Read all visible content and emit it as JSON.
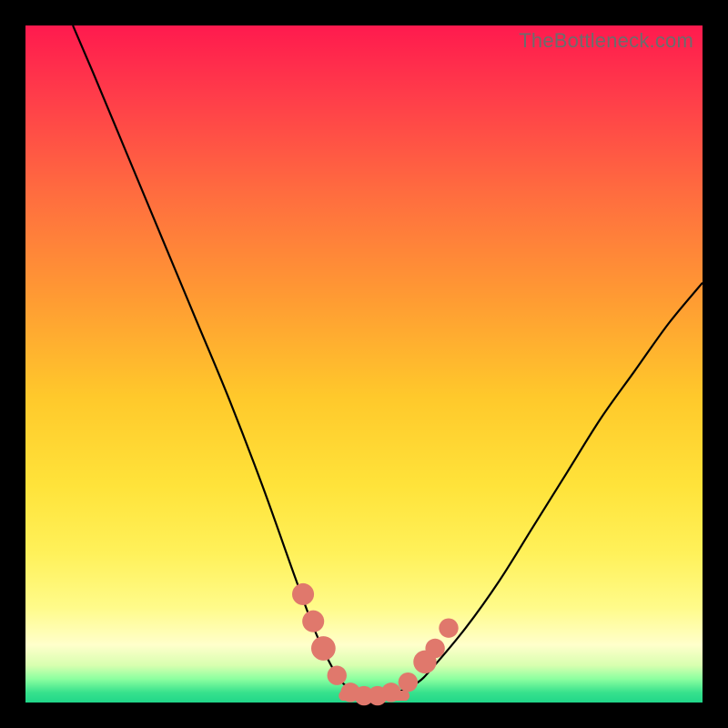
{
  "watermark": "TheBottleneck.com",
  "colors": {
    "page_bg": "#000000",
    "gradient_top": "#ff1a4e",
    "gradient_bottom": "#20d689",
    "curve": "#000000",
    "marker": "#e0786c"
  },
  "chart_data": {
    "type": "line",
    "title": "",
    "xlabel": "",
    "ylabel": "",
    "xlim": [
      0,
      100
    ],
    "ylim": [
      0,
      100
    ],
    "series": [
      {
        "name": "bottleneck-curve",
        "x": [
          7,
          10,
          15,
          20,
          25,
          30,
          35,
          40,
          43,
          46,
          48,
          50,
          52,
          54,
          56,
          58,
          60,
          65,
          70,
          75,
          80,
          85,
          90,
          95,
          100
        ],
        "y": [
          100,
          93,
          81,
          69,
          57,
          45,
          32,
          18,
          10,
          4,
          2,
          1,
          1,
          1,
          2,
          3,
          5,
          11,
          18,
          26,
          34,
          42,
          49,
          56,
          62
        ]
      }
    ],
    "markers": [
      {
        "x": 41,
        "y": 16,
        "r": 1.2
      },
      {
        "x": 42.5,
        "y": 12,
        "r": 1.2
      },
      {
        "x": 44,
        "y": 8,
        "r": 1.4
      },
      {
        "x": 46,
        "y": 4,
        "r": 1.0
      },
      {
        "x": 48,
        "y": 1.5,
        "r": 1.0
      },
      {
        "x": 50,
        "y": 1,
        "r": 1.0
      },
      {
        "x": 52,
        "y": 1,
        "r": 1.0
      },
      {
        "x": 54,
        "y": 1.5,
        "r": 1.0
      },
      {
        "x": 56.5,
        "y": 3,
        "r": 1.0
      },
      {
        "x": 59,
        "y": 6,
        "r": 1.3
      },
      {
        "x": 60.5,
        "y": 8,
        "r": 1.0
      },
      {
        "x": 62.5,
        "y": 11,
        "r": 1.0
      }
    ],
    "floor_band": {
      "x0": 47,
      "x1": 56,
      "y": 1
    }
  }
}
